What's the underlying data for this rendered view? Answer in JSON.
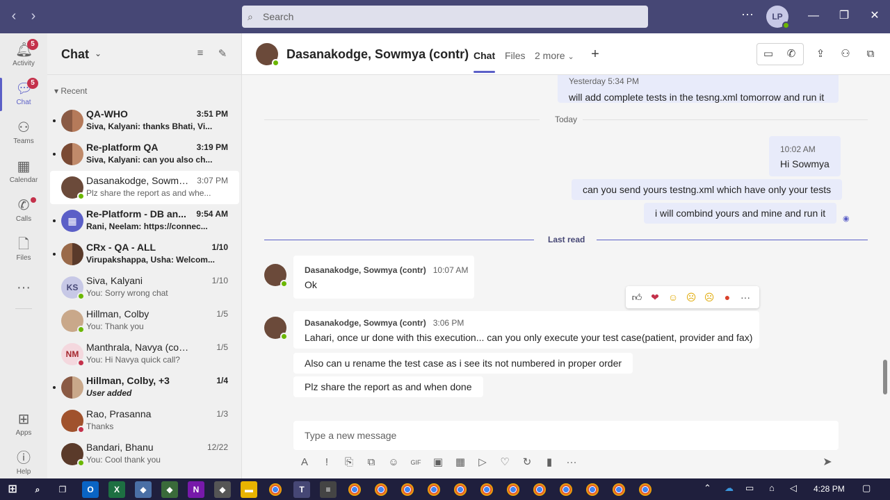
{
  "titlebar": {
    "search_placeholder": "Search",
    "avatar_initials": "LP"
  },
  "rail": {
    "items": [
      {
        "label": "Activity",
        "icon": "bell-icon",
        "badge": "5"
      },
      {
        "label": "Chat",
        "icon": "chat-icon",
        "badge": "5"
      },
      {
        "label": "Teams",
        "icon": "teams-icon"
      },
      {
        "label": "Calendar",
        "icon": "calendar-icon"
      },
      {
        "label": "Calls",
        "icon": "phone-icon"
      },
      {
        "label": "Files",
        "icon": "file-icon"
      },
      {
        "label": "Apps",
        "icon": "apps-icon"
      },
      {
        "label": "Help",
        "icon": "help-icon"
      }
    ]
  },
  "chatlist": {
    "title": "Chat",
    "section": "Recent",
    "items": [
      {
        "name": "QA-WHO",
        "time": "3:51 PM",
        "preview": "Siva, Kalyani: thanks Bhati, Vi...",
        "unread": true
      },
      {
        "name": "Re-platform QA",
        "time": "3:19 PM",
        "preview": "Siva, Kalyani: can you also ch...",
        "unread": true
      },
      {
        "name": "Dasanakodge, Sowmya...",
        "time": "3:07 PM",
        "preview": "Plz share the report as and whe...",
        "unread": false,
        "selected": true
      },
      {
        "name": "Re-Platform - DB an...",
        "time": "9:54 AM",
        "preview": "Rani, Neelam: https://connec...",
        "unread": true
      },
      {
        "name": "CRx - QA - ALL",
        "time": "1/10",
        "preview": "Virupakshappa, Usha: Welcom...",
        "unread": true
      },
      {
        "name": "Siva, Kalyani",
        "time": "1/10",
        "preview": "You: Sorry wrong chat",
        "initials": "KS"
      },
      {
        "name": "Hillman, Colby",
        "time": "1/5",
        "preview": "You: Thank you"
      },
      {
        "name": "Manthrala, Navya (contr)",
        "time": "1/5",
        "preview": "You: Hi Navya quick call?",
        "initials": "NM"
      },
      {
        "name": "Hillman, Colby, +3",
        "time": "1/4",
        "preview": "User added",
        "unread": true
      },
      {
        "name": "Rao, Prasanna",
        "time": "1/3",
        "preview": "Thanks"
      },
      {
        "name": "Bandari, Bhanu",
        "time": "12/22",
        "preview": "You: Cool thank you"
      }
    ]
  },
  "conversation": {
    "contact": "Dasanakodge, Sowmya (contr)",
    "tabs": [
      "Chat",
      "Files",
      "2 more"
    ],
    "prev_meta": "Yesterday 5:34 PM",
    "prev_msg": "will add complete tests in the tesng.xml tomorrow and run it",
    "day_divider": "Today",
    "my_time": "10:02 AM",
    "my_msgs": [
      "Hi Sowmya",
      "can you send yours testng.xml which have only your tests",
      "i will combind yours and mine and run it"
    ],
    "last_read": "Last read",
    "msg1": {
      "sender": "Dasanakodge, Sowmya (contr)",
      "time": "10:07 AM",
      "text": "Ok"
    },
    "msg2": {
      "sender": "Dasanakodge, Sowmya (contr)",
      "time": "3:06 PM",
      "texts": [
        "Lahari, once ur done with this execution... can you only execute your test case(patient, provider and fax)",
        "Also can u rename the test case as i see its not numbered in proper order",
        "Plz share the report as and when done"
      ]
    },
    "compose_placeholder": "Type a new message"
  },
  "taskbar": {
    "time": "4:28 PM"
  },
  "colors": {
    "titlebar": "#464775",
    "accent": "#5b5fc7",
    "badge": "#c4314b",
    "available": "#6bb700"
  }
}
